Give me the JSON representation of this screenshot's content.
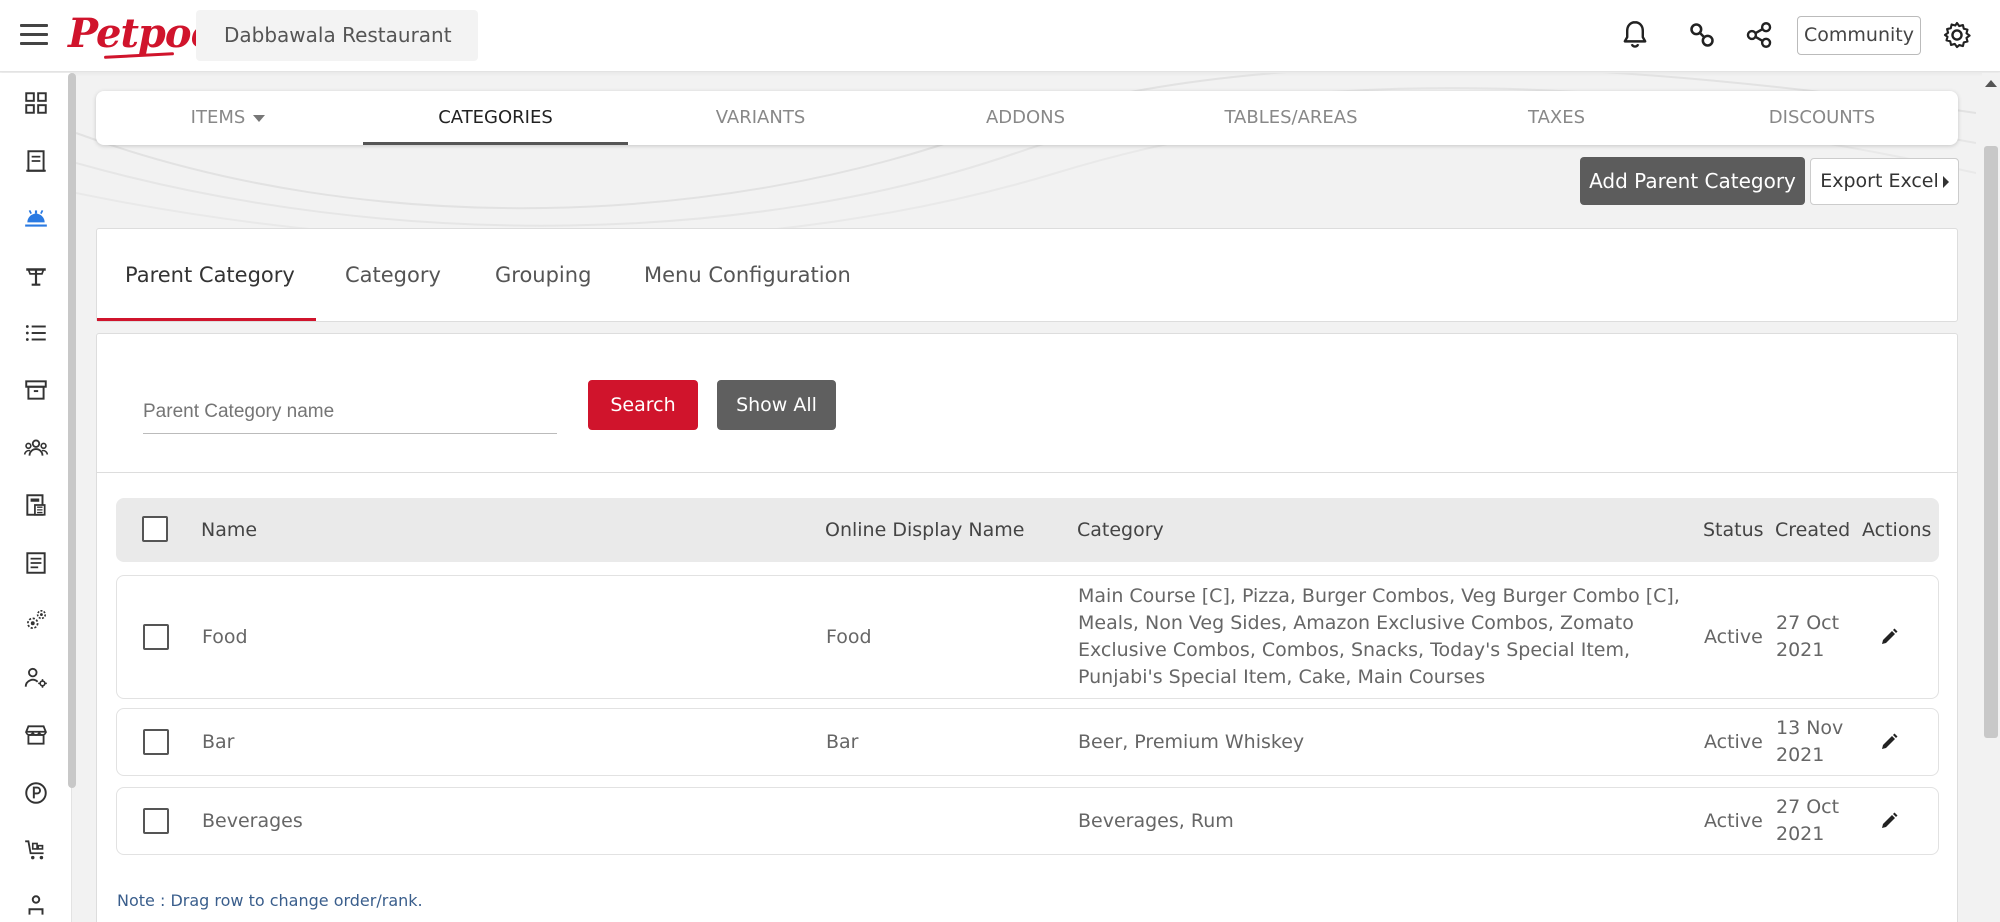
{
  "header": {
    "logo_text": "Petpooja",
    "restaurant_name": "Dabbawala Restaurant",
    "community_label": "Community",
    "icons": [
      "hamburger-icon",
      "bell-icon",
      "link-icon",
      "share-icon",
      "gear-icon"
    ]
  },
  "sidebar": {
    "icons": [
      "dashboard-icon",
      "billing-icon",
      "menu-icon",
      "table-icon",
      "list-icon",
      "inventory-icon",
      "customers-icon",
      "calculator-icon",
      "reports-icon",
      "integrations-icon",
      "user-settings-icon",
      "store-icon",
      "payments-icon",
      "purchase-icon",
      "staff-icon"
    ],
    "active_index": 2
  },
  "main_tabs": [
    {
      "label": "ITEMS",
      "has_dropdown": true
    },
    {
      "label": "CATEGORIES",
      "active": true
    },
    {
      "label": "VARIANTS"
    },
    {
      "label": "ADDONS"
    },
    {
      "label": "TABLES/AREAS"
    },
    {
      "label": "TAXES"
    },
    {
      "label": "DISCOUNTS"
    }
  ],
  "actions": {
    "add_parent_category": "Add Parent Category",
    "export_excel": "Export Excel"
  },
  "sub_tabs": [
    {
      "label": "Parent Category",
      "active": true
    },
    {
      "label": "Category"
    },
    {
      "label": "Grouping"
    },
    {
      "label": "Menu Configuration"
    }
  ],
  "search": {
    "placeholder": "Parent Category name",
    "search_label": "Search",
    "show_all_label": "Show All"
  },
  "table": {
    "columns": [
      "Name",
      "Online Display Name",
      "Category",
      "Status",
      "Created",
      "Actions"
    ],
    "rows": [
      {
        "name": "Food",
        "online_display_name": "Food",
        "category": "Main Course [C], Pizza, Burger Combos, Veg Burger Combo [C], Meals, Non Veg Sides, Amazon Exclusive Combos, Zomato Exclusive Combos, Combos, Snacks, Today's Special Item, Punjabi's Special Item, Cake, Main Courses",
        "status": "Active",
        "created_line1": "27 Oct",
        "created_line2": "2021"
      },
      {
        "name": "Bar",
        "online_display_name": "Bar",
        "category": "Beer, Premium Whiskey",
        "status": "Active",
        "created_line1": "13 Nov",
        "created_line2": "2021"
      },
      {
        "name": "Beverages",
        "online_display_name": "",
        "category": "Beverages, Rum",
        "status": "Active",
        "created_line1": "27 Oct",
        "created_line2": "2021"
      }
    ]
  },
  "note": "Note : Drag row to change order/rank.",
  "colors": {
    "brand_red": "#d0142c",
    "dark_button": "#5c5c5c",
    "note_blue": "#3a5e8c"
  }
}
